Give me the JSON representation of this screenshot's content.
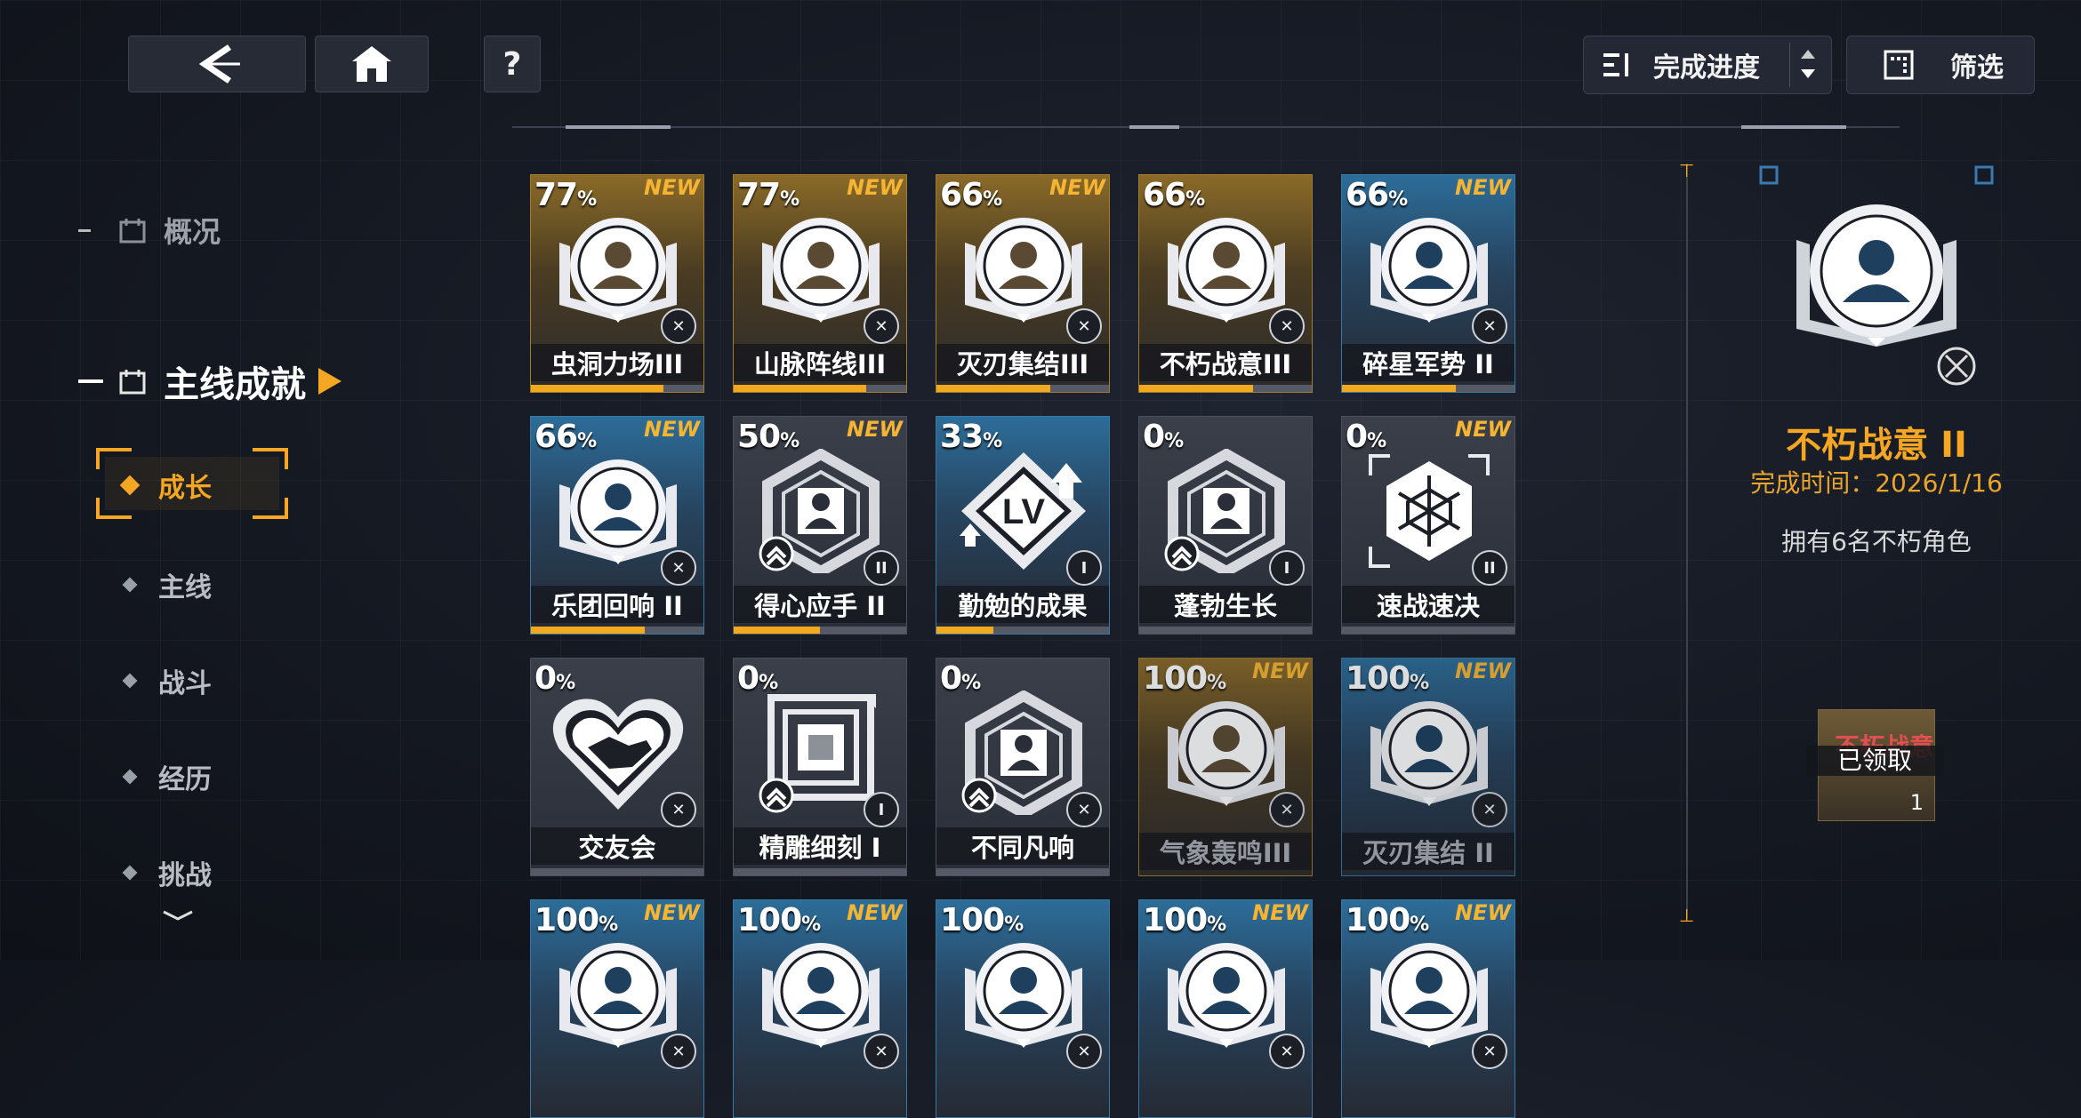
{
  "top_bar": {
    "back_icon": "back-arrow-icon",
    "home_icon": "home-icon",
    "help_label": "?",
    "sort_label": "完成进度",
    "sort_icon": "sort-icon",
    "filter_label": "筛选",
    "filter_icon": "filter-icon"
  },
  "sidebar": {
    "overview": "概况",
    "main_section": "主线成就",
    "sub_items": [
      "成长",
      "主线",
      "战斗",
      "经历",
      "挑战"
    ],
    "selected_sub": "成长"
  },
  "cards": [
    {
      "name": "虫洞力场III",
      "pct": "77",
      "new": "NEW",
      "theme": "gold",
      "icon": "book-avatar",
      "progress": 0.77
    },
    {
      "name": "山脉阵线III",
      "pct": "77",
      "new": "NEW",
      "theme": "gold",
      "icon": "book-avatar",
      "progress": 0.77
    },
    {
      "name": "灭刃集结III",
      "pct": "66",
      "new": "NEW",
      "theme": "gold",
      "icon": "book-avatar",
      "progress": 0.66
    },
    {
      "name": "不朽战意III",
      "pct": "66",
      "new": "",
      "theme": "gold",
      "icon": "book-avatar",
      "progress": 0.66
    },
    {
      "name": "碎星军势 II",
      "pct": "66",
      "new": "NEW",
      "theme": "blue",
      "icon": "book-avatar",
      "progress": 0.66
    },
    {
      "name": "乐团回响 II",
      "pct": "66",
      "new": "NEW",
      "theme": "blue",
      "icon": "book-avatar",
      "progress": 0.66
    },
    {
      "name": "得心应手 II",
      "pct": "50",
      "new": "NEW",
      "theme": "grey",
      "icon": "hex-avatar",
      "badge": "II",
      "progress": 0.5
    },
    {
      "name": "勤勉的成果",
      "pct": "33",
      "new": "",
      "theme": "blue",
      "icon": "lv-diamond",
      "badge": "I",
      "progress": 0.33
    },
    {
      "name": "蓬勃生长",
      "pct": "0",
      "new": "",
      "theme": "grey",
      "icon": "hex-avatar",
      "badge": "I",
      "progress": 0
    },
    {
      "name": "速战速决",
      "pct": "0",
      "new": "NEW",
      "theme": "grey",
      "icon": "hex-net",
      "badge": "II",
      "progress": 0
    },
    {
      "name": "交友会",
      "pct": "0",
      "new": "",
      "theme": "grey",
      "icon": "heart-handshake",
      "progress": 0
    },
    {
      "name": "精雕细刻 I",
      "pct": "0",
      "new": "",
      "theme": "grey",
      "icon": "square-chip",
      "badge": "I",
      "progress": 0
    },
    {
      "name": "不同凡响",
      "pct": "0",
      "new": "",
      "theme": "grey",
      "icon": "hex-avatar",
      "progress": 0
    },
    {
      "name": "气象轰鸣III",
      "pct": "100",
      "new": "NEW",
      "theme": "gold",
      "icon": "book-avatar",
      "claimed": true,
      "progress": 1
    },
    {
      "name": "灭刃集结 II",
      "pct": "100",
      "new": "NEW",
      "theme": "blue",
      "icon": "book-avatar",
      "claimed": true,
      "progress": 1
    },
    {
      "name": "",
      "pct": "100",
      "new": "NEW",
      "theme": "blue",
      "icon": "book-avatar",
      "progress": 1
    },
    {
      "name": "",
      "pct": "100",
      "new": "NEW",
      "theme": "blue",
      "icon": "book-avatar",
      "progress": 1
    },
    {
      "name": "",
      "pct": "100",
      "new": "",
      "theme": "blue",
      "icon": "book-avatar",
      "progress": 1
    },
    {
      "name": "",
      "pct": "100",
      "new": "NEW",
      "theme": "blue",
      "icon": "book-avatar",
      "progress": 1
    },
    {
      "name": "",
      "pct": "100",
      "new": "NEW",
      "theme": "blue",
      "icon": "book-avatar",
      "progress": 1
    }
  ],
  "percent_sign": "%",
  "detail": {
    "title": "不朽战意 II",
    "time": "完成时间：2026/1/16",
    "desc": "拥有6名不朽角色",
    "reward_status": "已领取",
    "reward_count": "1",
    "reward_name": "不朽战意"
  },
  "colors": {
    "accent": "#f5a623",
    "gold_card": "#8a6a28",
    "blue_card": "#2c6d99",
    "progress": "#f3a91d"
  }
}
